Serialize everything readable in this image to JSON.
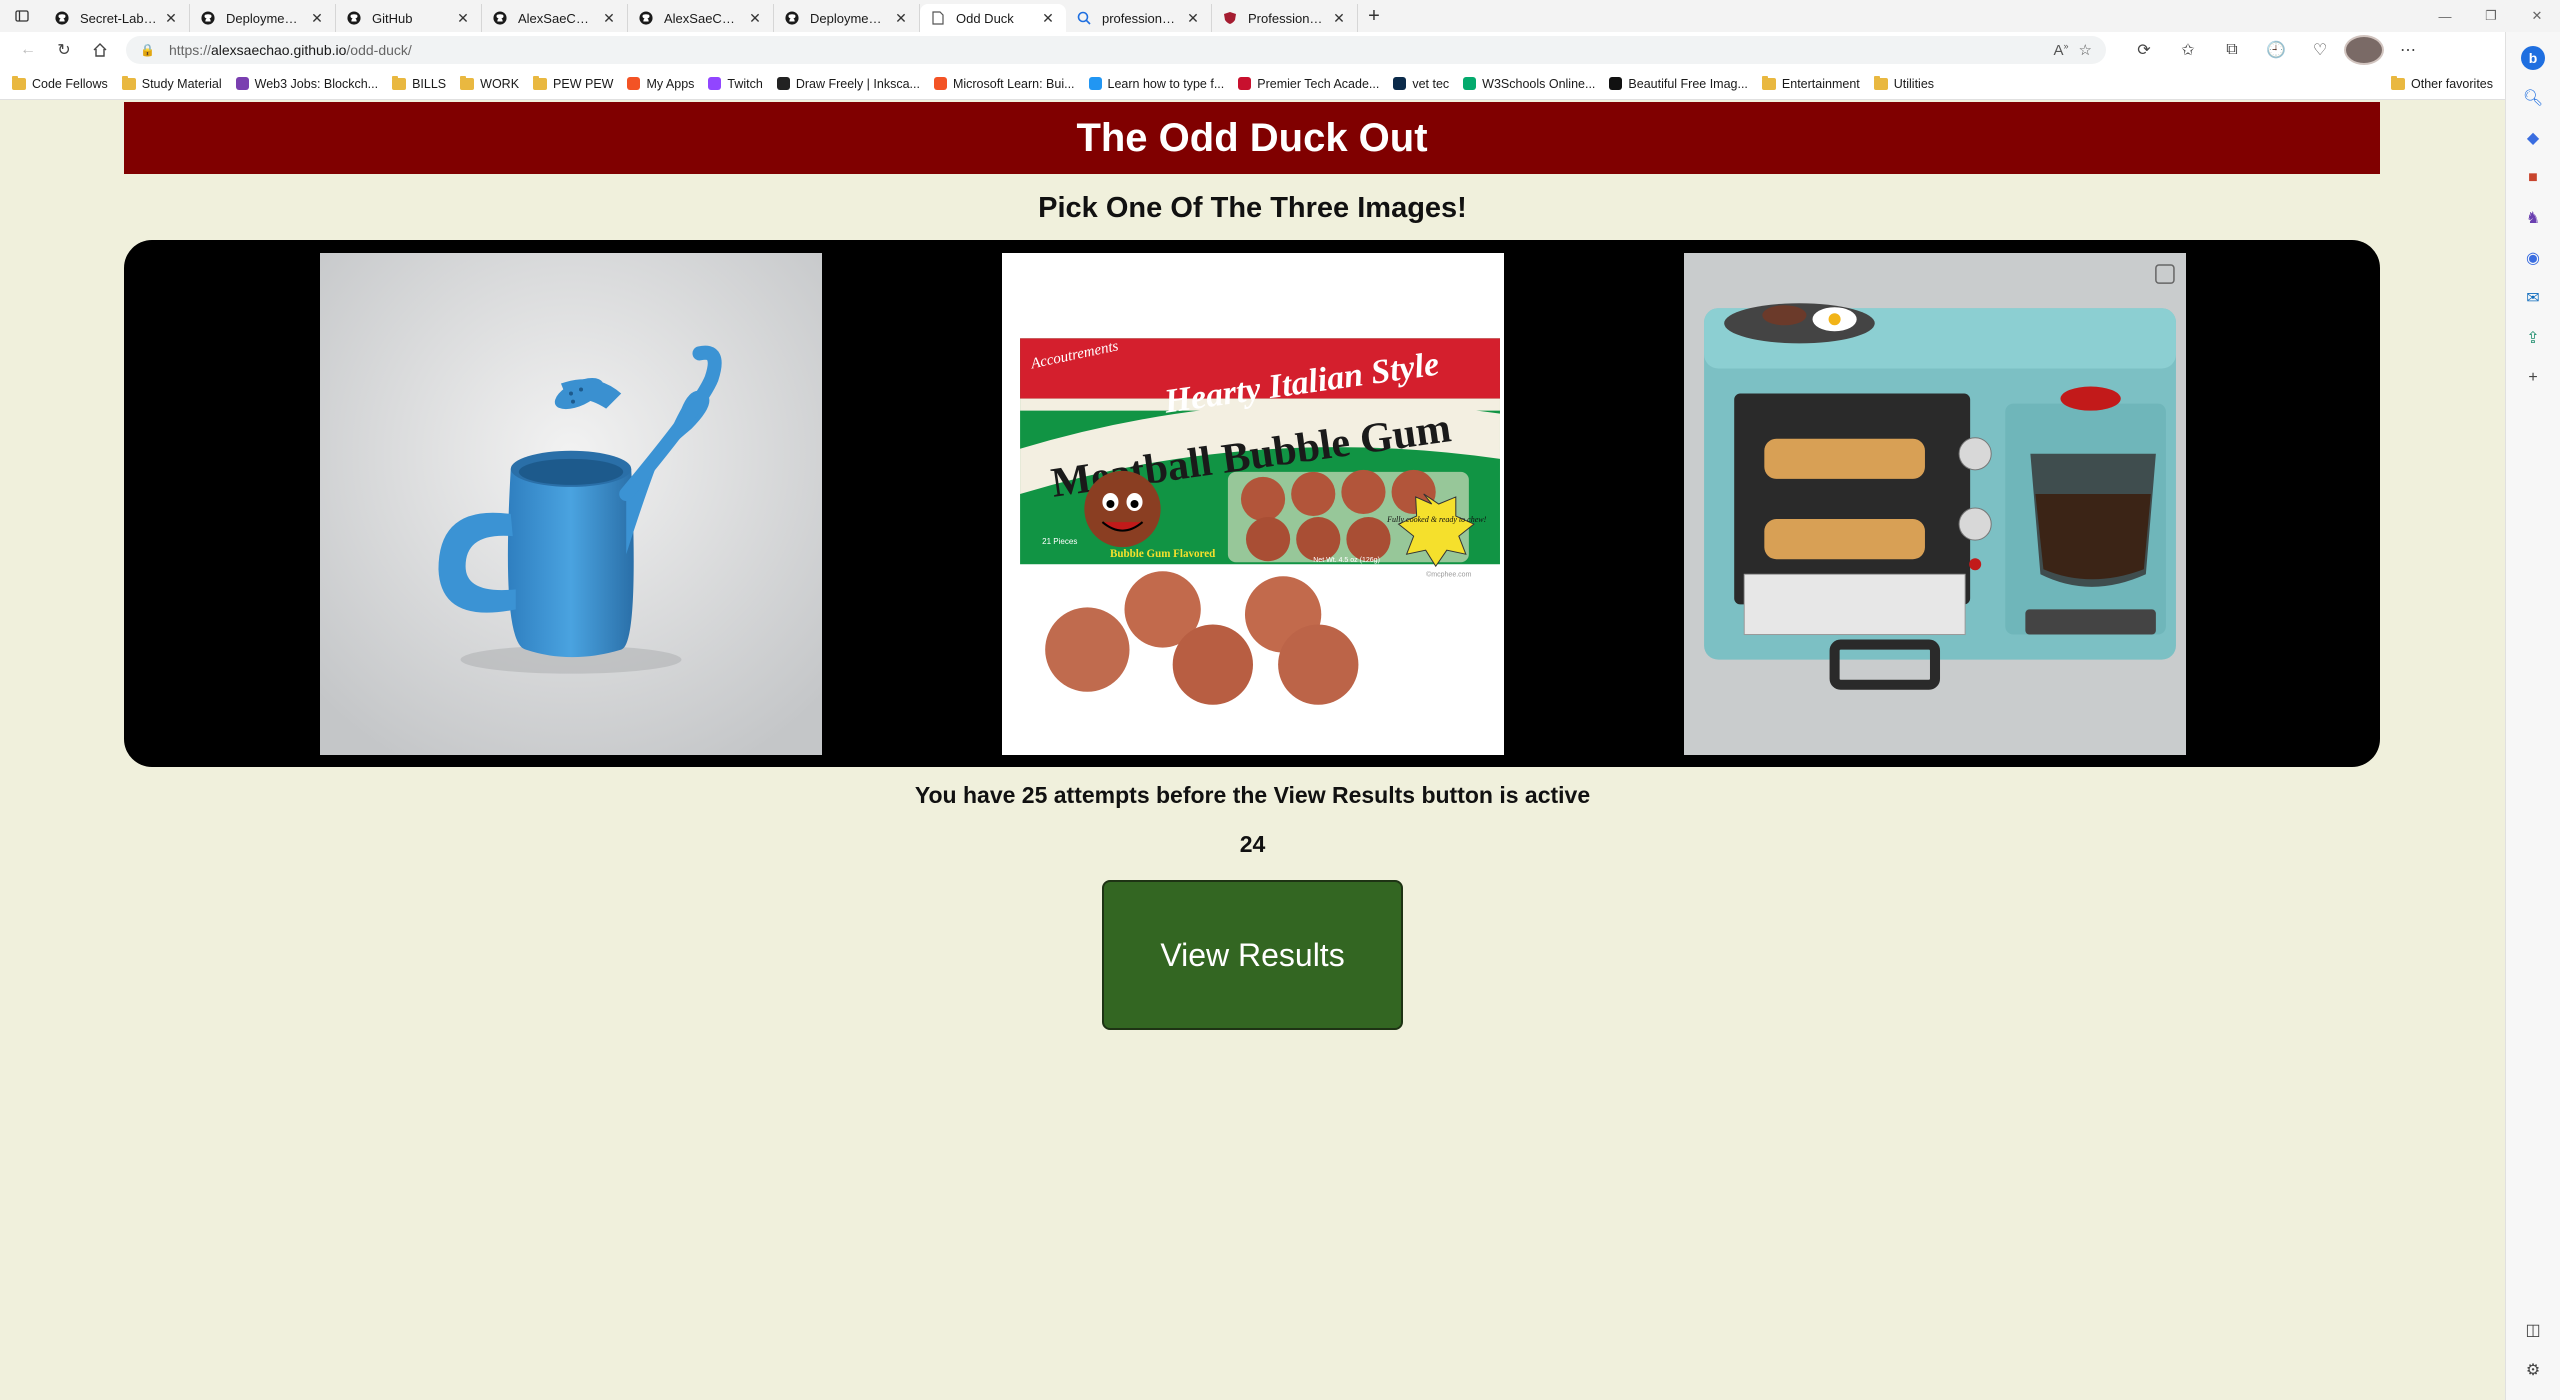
{
  "browser": {
    "tabs": [
      {
        "title": "Secret-Laboratory-Org/hobby-g",
        "icon": "github-icon"
      },
      {
        "title": "Deployments · Secret-Laboratory",
        "icon": "github-icon"
      },
      {
        "title": "GitHub",
        "icon": "github-icon"
      },
      {
        "title": "AlexSaeChao/cookie-stand: Lab",
        "icon": "github-icon"
      },
      {
        "title": "AlexSaeChao/odd-duck",
        "icon": "github-icon"
      },
      {
        "title": "Deployments · AlexSaeChao/odd",
        "icon": "github-icon"
      },
      {
        "title": "Odd Duck",
        "icon": "page-icon",
        "active": true
      },
      {
        "title": "professionalism courses - Search",
        "icon": "search-icon"
      },
      {
        "title": "Professional Development | Harv",
        "icon": "shield-icon"
      }
    ],
    "url": {
      "scheme": "https://",
      "host": "alexsaechao.github.io",
      "path": "/odd-duck/"
    },
    "bookmarks": [
      {
        "label": "Code Fellows",
        "icon": "folder-icon"
      },
      {
        "label": "Study Material",
        "icon": "folder-icon"
      },
      {
        "label": "Web3 Jobs: Blockch...",
        "icon": "web3-icon"
      },
      {
        "label": "BILLS",
        "icon": "folder-icon"
      },
      {
        "label": "WORK",
        "icon": "folder-icon"
      },
      {
        "label": "PEW PEW",
        "icon": "folder-icon"
      },
      {
        "label": "My Apps",
        "icon": "apps-icon"
      },
      {
        "label": "Twitch",
        "icon": "twitch-icon"
      },
      {
        "label": "Draw Freely | Inksca...",
        "icon": "inkscape-icon"
      },
      {
        "label": "Microsoft Learn: Bui...",
        "icon": "microsoft-icon"
      },
      {
        "label": "Learn how to type f...",
        "icon": "typing-icon"
      },
      {
        "label": "Premier Tech Acade...",
        "icon": "shield-icon"
      },
      {
        "label": "vet tec",
        "icon": "va-icon"
      },
      {
        "label": "W3Schools Online...",
        "icon": "w3schools-icon"
      },
      {
        "label": "Beautiful Free Imag...",
        "icon": "unsplash-icon"
      },
      {
        "label": "Entertainment",
        "icon": "folder-icon"
      },
      {
        "label": "Utilities",
        "icon": "folder-icon"
      }
    ],
    "other_favorites": "Other favorites"
  },
  "app": {
    "title": "The Odd Duck Out",
    "instruction": "Pick One Of The Three Images!",
    "attempts_text": "You have 25 attempts before the View Results button is active",
    "remaining": "24",
    "results_button": "View Results",
    "images": [
      {
        "subject": "watering-can-mug"
      },
      {
        "subject": "meatball-bubble-gum",
        "box_text_top": "Hearty Italian Style",
        "box_text_main": "Meatball Bubble Gum",
        "box_text_small": "Bubble Gum Flavored",
        "badge": "Fully cooked & ready to chew!",
        "count": "21 Pieces",
        "weight": "Net Wt. 4.5 oz (126g)",
        "brand": "Accoutrements",
        "watermark": "©mcphee.com"
      },
      {
        "subject": "breakfast-station-toaster"
      }
    ]
  },
  "colors": {
    "header_bg": "#800000",
    "page_bg": "#f0f0dc",
    "panel_bg": "#000000",
    "button_bg": "#336622"
  }
}
